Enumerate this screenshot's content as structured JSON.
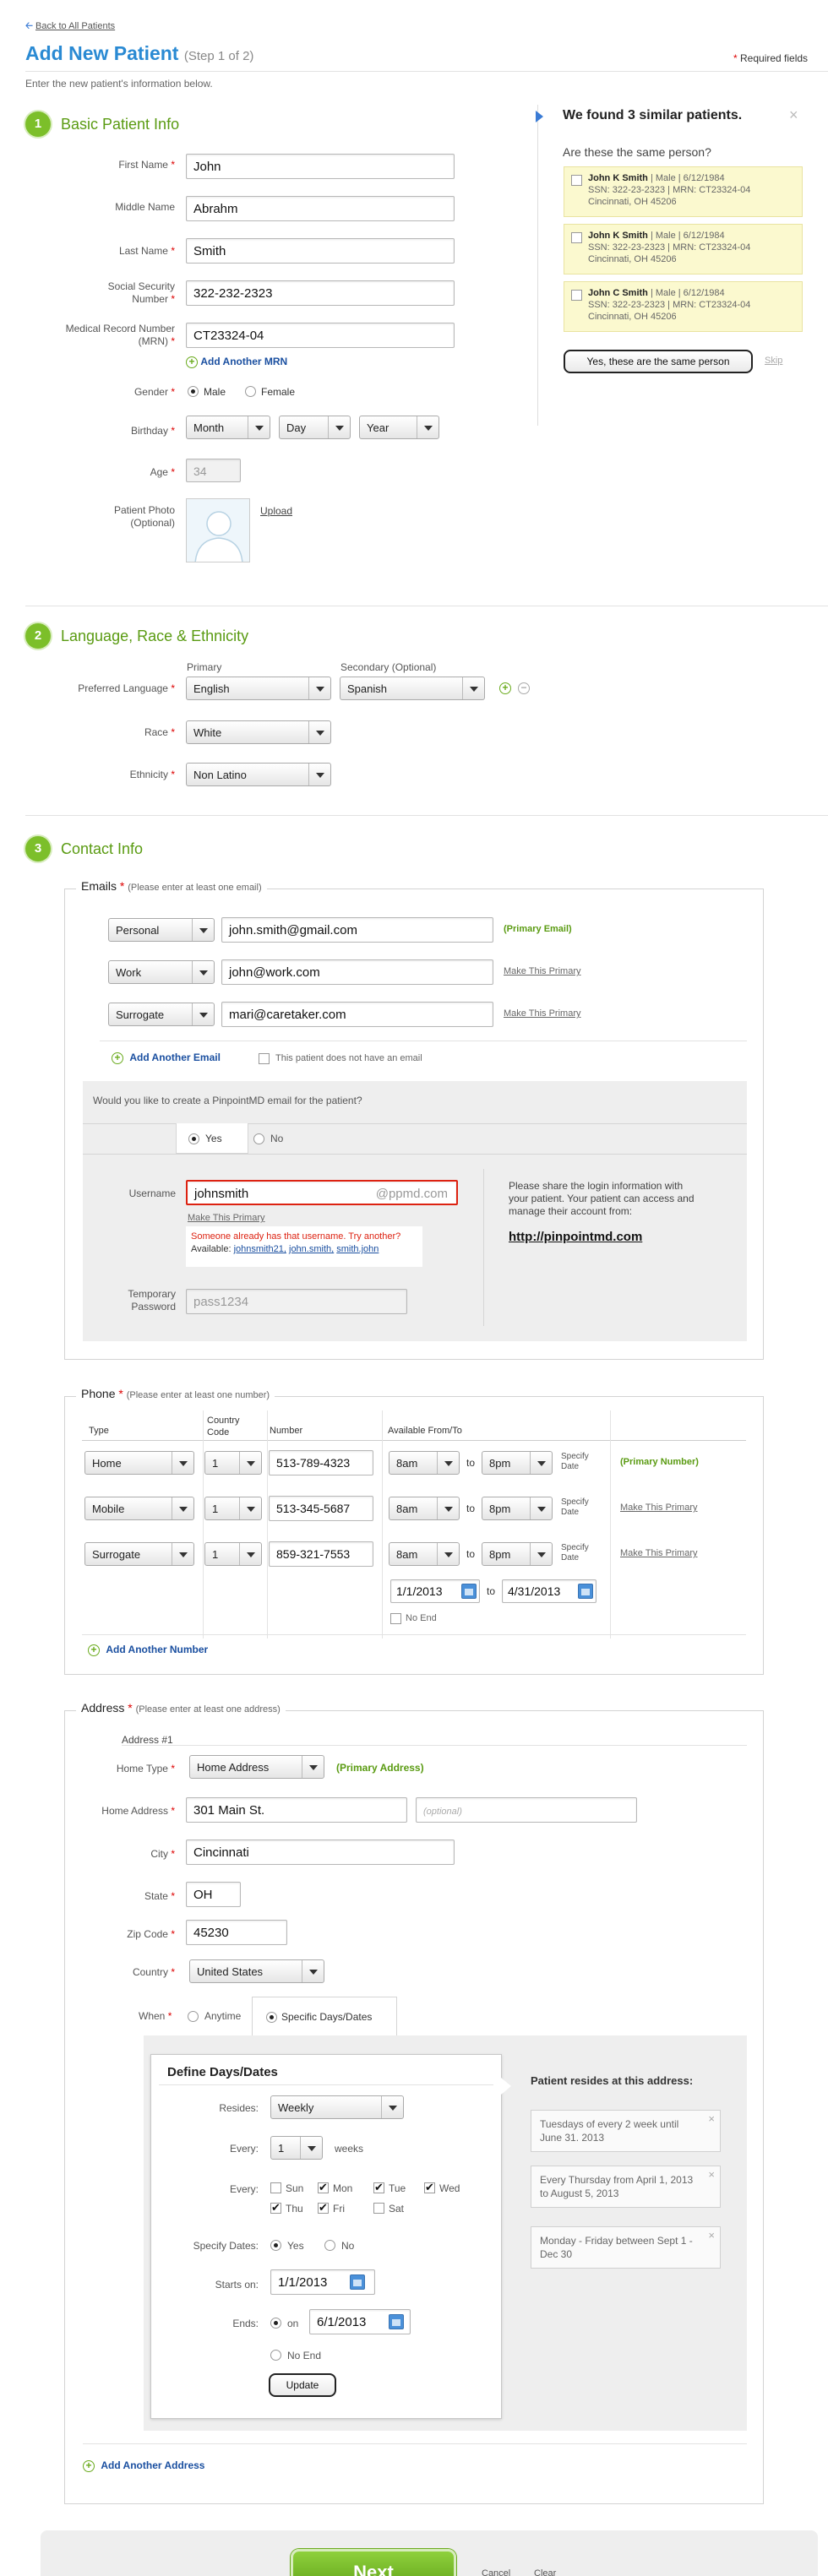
{
  "header": {
    "back_link": "Back to All Patients",
    "title": "Add New Patient",
    "step": "(Step 1 of 2)",
    "required_fields": "Required fields",
    "instructions": "Enter the new patient's information below."
  },
  "section1": {
    "number": "1",
    "title": "Basic Patient Info",
    "first_name_label": "First Name",
    "first_name": "John",
    "middle_name_label": "Middle Name",
    "middle_name": "Abrahm",
    "last_name_label": "Last Name",
    "last_name": "Smith",
    "ssn_label_1": "Social Security",
    "ssn_label_2": "Number",
    "ssn": "322-232-2323",
    "mrn_label_1": "Medical Record Number",
    "mrn_label_2": "(MRN)",
    "mrn": "CT23324-04",
    "add_mrn": "Add Another MRN",
    "gender_label": "Gender",
    "gender_male": "Male",
    "gender_female": "Female",
    "birthday_label": "Birthday",
    "birthday_month": "Month",
    "birthday_day": "Day",
    "birthday_year": "Year",
    "age_label": "Age",
    "age": "34",
    "photo_label_1": "Patient Photo",
    "photo_label_2": "(Optional)",
    "upload": "Upload"
  },
  "similar": {
    "title": "We found 3 similar patients.",
    "question": "Are these the same person?",
    "patients": [
      {
        "name": "John K Smith",
        "meta": "| Male | 6/12/1984",
        "ids": "SSN: 322-23-2323 | MRN: CT23324-04",
        "addr": "Cincinnati, OH 45206"
      },
      {
        "name": "John K Smith",
        "meta": "| Male | 6/12/1984",
        "ids": "SSN: 322-23-2323 | MRN: CT23324-04",
        "addr": "Cincinnati, OH 45206"
      },
      {
        "name": "John C Smith",
        "meta": "| Male | 6/12/1984",
        "ids": "SSN: 322-23-2323 | MRN: CT23324-04",
        "addr": "Cincinnati, OH 45206"
      }
    ],
    "same_button": "Yes, these are the same person",
    "skip": "Skip",
    "close": "×"
  },
  "section2": {
    "number": "2",
    "title": "Language, Race & Ethnicity",
    "primary_header": "Primary",
    "secondary_header": "Secondary (Optional)",
    "language_label": "Preferred Language",
    "primary_language": "English",
    "secondary_language": "Spanish",
    "race_label": "Race",
    "race": "White",
    "ethnicity_label": "Ethnicity",
    "ethnicity": "Non Latino"
  },
  "section3": {
    "number": "3",
    "title": "Contact Info"
  },
  "emails": {
    "legend": "Emails",
    "note": "(Please enter at least one email)",
    "rows": [
      {
        "type": "Personal",
        "value": "john.smith@gmail.com",
        "status": "(Primary Email)"
      },
      {
        "type": "Work",
        "value": "john@work.com",
        "status": "Make This Primary"
      },
      {
        "type": "Surrogate",
        "value": "mari@caretaker.com",
        "status": "Make This Primary"
      }
    ],
    "add": "Add Another Email",
    "no_email": "This patient does not have an email",
    "create_question": "Would you like to create a PinpointMD email for the patient?",
    "yes": "Yes",
    "no": "No",
    "username_label": "Username",
    "username": "johnsmith",
    "domain": "@ppmd.com",
    "make_primary": "Make This Primary",
    "taken": "Someone already has that username. Try another?",
    "available_label": "Available:",
    "suggestions": [
      "johnsmith21,",
      "john.smith,",
      "smith.john"
    ],
    "temp_label_1": "Temporary",
    "temp_label_2": "Password",
    "temp_password": "pass1234",
    "share_text": "Please share the login information with your patient. Your patient can access and manage their account from:",
    "share_url": "http://pinpointmd.com"
  },
  "phone": {
    "legend": "Phone",
    "note": "(Please enter at least one number)",
    "headers": {
      "type": "Type",
      "country_1": "Country",
      "country_2": "Code",
      "number": "Number",
      "available": "Available From/To"
    },
    "rows": [
      {
        "type": "Home",
        "code": "1",
        "number": "513-789-4323",
        "from": "8am",
        "to": "8pm",
        "status": "(Primary Number)"
      },
      {
        "type": "Mobile",
        "code": "1",
        "number": "513-345-5687",
        "from": "8am",
        "to": "8pm",
        "status": "Make This Primary"
      },
      {
        "type": "Surrogate",
        "code": "1",
        "number": "859-321-7553",
        "from": "8am",
        "to": "8pm",
        "status": "Make This Primary"
      }
    ],
    "to_word": "to",
    "specify_1": "Specify",
    "specify_2": "Date",
    "date_from": "1/1/2013",
    "date_to": "4/31/2013",
    "no_end": "No End",
    "add": "Add Another Number"
  },
  "address": {
    "legend": "Address",
    "note": "(Please enter at least one address)",
    "sub_title": "Address #1",
    "home_type_label": "Home Type",
    "home_type": "Home Address",
    "primary": "(Primary Address)",
    "home_address_label": "Home Address",
    "street": "301 Main St.",
    "street2_placeholder": "(optional)",
    "city_label": "City",
    "city": "Cincinnati",
    "state_label": "State",
    "state": "OH",
    "zip_label": "Zip Code",
    "zip": "45230",
    "country_label": "Country",
    "country": "United States",
    "when_label": "When",
    "anytime": "Anytime",
    "specific": "Specific Days/Dates",
    "define_title": "Define Days/Dates",
    "resides_label": "Resides:",
    "resides": "Weekly",
    "every_label": "Every:",
    "every_num": "1",
    "weeks": "weeks",
    "days_label": "Every:",
    "days": [
      {
        "name": "Sun",
        "on": false
      },
      {
        "name": "Mon",
        "on": true
      },
      {
        "name": "Tue",
        "on": true
      },
      {
        "name": "Wed",
        "on": true
      },
      {
        "name": "Thu",
        "on": true
      },
      {
        "name": "Fri",
        "on": true
      },
      {
        "name": "Sat",
        "on": false
      }
    ],
    "specify_dates_label": "Specify Dates:",
    "yes": "Yes",
    "no": "No",
    "starts_label": "Starts on:",
    "starts": "1/1/2013",
    "ends_label": "Ends:",
    "ends_on": "on",
    "ends": "6/1/2013",
    "no_end": "No End",
    "update": "Update",
    "resides_title": "Patient resides at this address:",
    "resides_items": [
      "Tuesdays of every 2 week until June 31. 2013",
      "Every Thursday from April 1, 2013  to August 5, 2013",
      "Monday - Friday between Sept 1 - Dec 30"
    ],
    "add": "Add Another Address"
  },
  "footer": {
    "next": "Next",
    "cancel": "Cancel",
    "clear": "Clear"
  }
}
